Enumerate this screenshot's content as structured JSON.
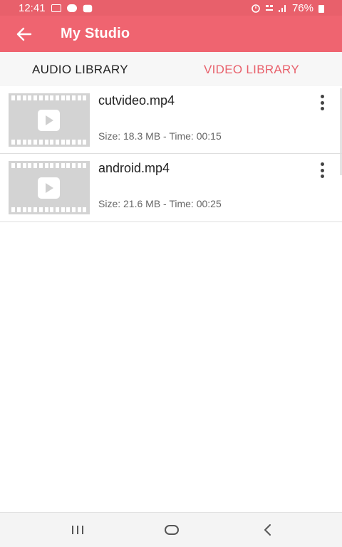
{
  "status_bar": {
    "time": "12:41",
    "battery": "76%"
  },
  "app_bar": {
    "title": "My Studio",
    "back_icon": "arrow-left-icon"
  },
  "tabs": [
    {
      "label": "AUDIO LIBRARY",
      "selected": false
    },
    {
      "label": "VIDEO LIBRARY",
      "selected": true
    }
  ],
  "videos": [
    {
      "filename": "cutvideo.mp4",
      "info": "Size: 18.3 MB - Time: 00:15"
    },
    {
      "filename": "android.mp4",
      "info": "Size: 21.6 MB - Time: 00:25"
    }
  ],
  "colors": {
    "accent": "#ef6470",
    "status_bar": "#e8606b",
    "selected_tab": "#e8606b"
  },
  "nav_bar": {
    "recent_icon": "recent-apps-icon",
    "home_icon": "home-icon",
    "back_icon": "back-chevron-icon"
  }
}
